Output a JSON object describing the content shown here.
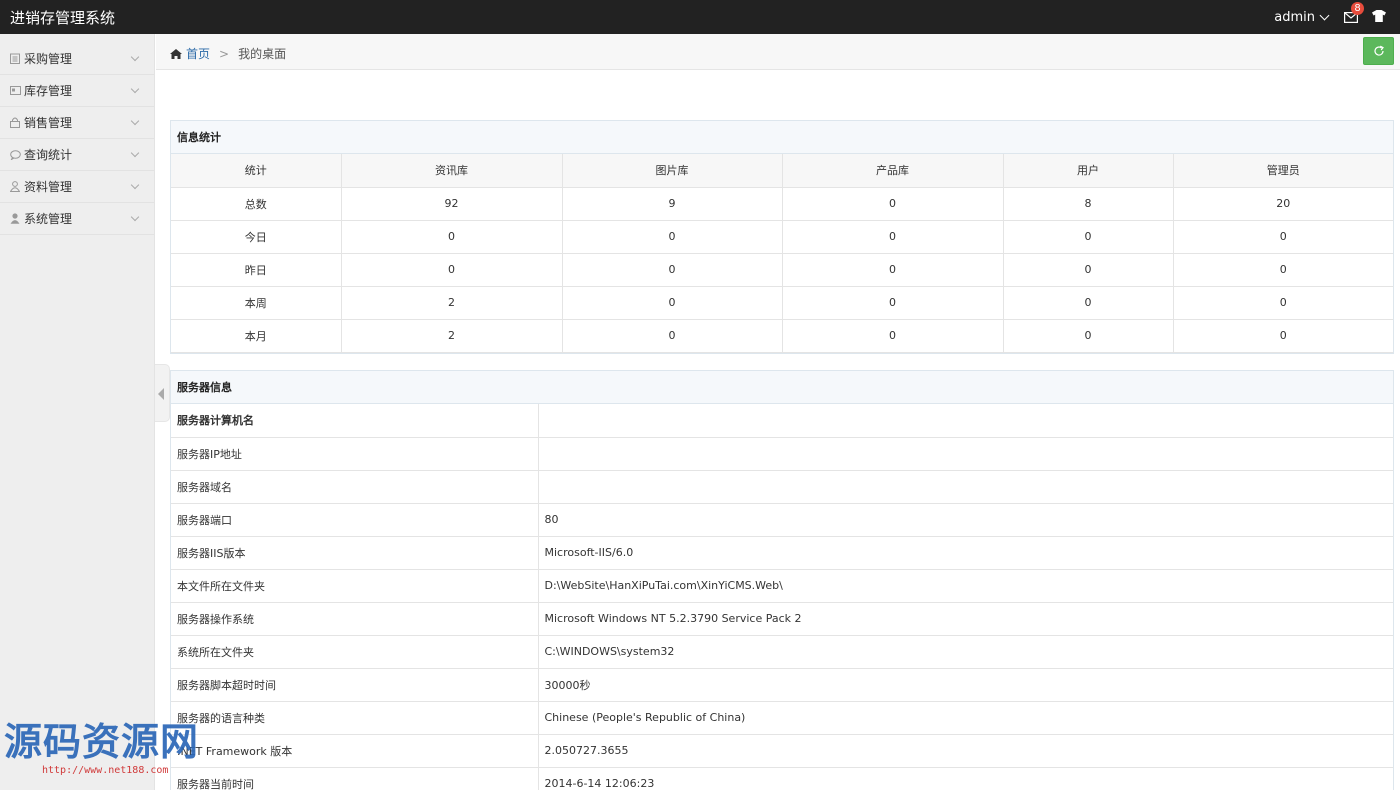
{
  "app": {
    "title": "进销存管理系统"
  },
  "topbar": {
    "user": "admin",
    "mail_count": "8"
  },
  "sidebar": {
    "items": [
      {
        "label": "采购管理",
        "icon": "clipboard-icon"
      },
      {
        "label": "库存管理",
        "icon": "card-icon"
      },
      {
        "label": "销售管理",
        "icon": "lock-icon"
      },
      {
        "label": "查询统计",
        "icon": "chat-icon"
      },
      {
        "label": "资料管理",
        "icon": "user-outline-icon"
      },
      {
        "label": "系统管理",
        "icon": "user-solid-icon"
      }
    ]
  },
  "breadcrumb": {
    "home": "首页",
    "separator": ">",
    "current": "我的桌面"
  },
  "stats": {
    "title": "信息统计",
    "headers": [
      "统计",
      "资讯库",
      "图片库",
      "产品库",
      "用户",
      "管理员"
    ],
    "rows": [
      [
        "总数",
        "92",
        "9",
        "0",
        "8",
        "20"
      ],
      [
        "今日",
        "0",
        "0",
        "0",
        "0",
        "0"
      ],
      [
        "昨日",
        "0",
        "0",
        "0",
        "0",
        "0"
      ],
      [
        "本周",
        "2",
        "0",
        "0",
        "0",
        "0"
      ],
      [
        "本月",
        "2",
        "0",
        "0",
        "0",
        "0"
      ]
    ]
  },
  "server": {
    "title": "服务器信息",
    "rows": [
      [
        "服务器计算机名",
        ""
      ],
      [
        "服务器IP地址",
        ""
      ],
      [
        "服务器域名",
        ""
      ],
      [
        "服务器端口",
        "80"
      ],
      [
        "服务器IIS版本",
        "Microsoft-IIS/6.0"
      ],
      [
        "本文件所在文件夹",
        "D:\\WebSite\\HanXiPuTai.com\\XinYiCMS.Web\\"
      ],
      [
        "服务器操作系统",
        "Microsoft Windows NT 5.2.3790 Service Pack 2"
      ],
      [
        "系统所在文件夹",
        "C:\\WINDOWS\\system32"
      ],
      [
        "服务器脚本超时时间",
        "30000秒"
      ],
      [
        "服务器的语言种类",
        "Chinese (People's Republic of China)"
      ],
      [
        ".NET Framework 版本",
        "2.050727.3655"
      ],
      [
        "服务器当前时间",
        "2014-6-14 12:06:23"
      ]
    ]
  },
  "watermark": {
    "text": "源码资源网",
    "url": "http://www.net188.com"
  },
  "colors": {
    "topbar": "#222222",
    "link": "#2d6ba8",
    "refresh": "#5cb85c",
    "badge": "#e74c3c"
  }
}
